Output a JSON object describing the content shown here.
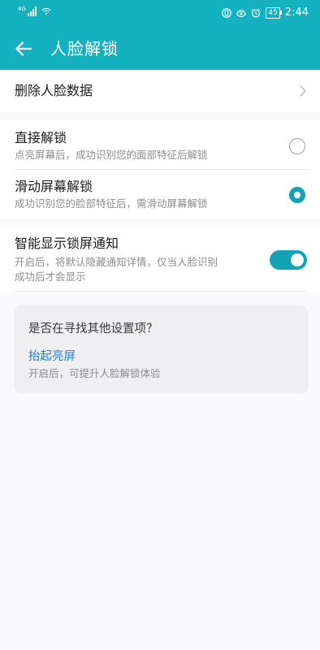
{
  "status_bar": {
    "network_label": "4G",
    "battery_level": "45",
    "time": "2:44",
    "icons": [
      "signal-icon",
      "wifi-icon",
      "vibrate-icon",
      "eye-comfort-icon",
      "alarm-icon",
      "battery-icon"
    ]
  },
  "app_bar": {
    "back_icon": "back-arrow-icon",
    "title": "人脸解锁"
  },
  "delete_section": {
    "label": "删除人脸数据",
    "icon": "chevron-right-icon"
  },
  "unlock_mode": {
    "options": [
      {
        "title": "直接解锁",
        "description": "点亮屏幕后，成功识别您的面部特征后解锁",
        "selected": false
      },
      {
        "title": "滑动屏幕解锁",
        "description": "成功识别您的脸部特征后，需滑动屏幕解锁",
        "selected": true
      }
    ]
  },
  "notification": {
    "title": "智能显示锁屏通知",
    "description_line1": "开启后，将默认隐藏通知详情，仅当人脸识别",
    "description_line2": "成功后才会显示",
    "enabled": true
  },
  "suggestion_card": {
    "question": "是否在寻找其他设置项？",
    "link": "抬起亮屏",
    "description": "开启后，可提升人脸解锁体验"
  },
  "colors": {
    "accent": "#14b1c1",
    "control": "#14a3b3",
    "link": "#1a7fd1",
    "secondary_text": "#8d8d8d",
    "background": "#f9f9fb"
  }
}
